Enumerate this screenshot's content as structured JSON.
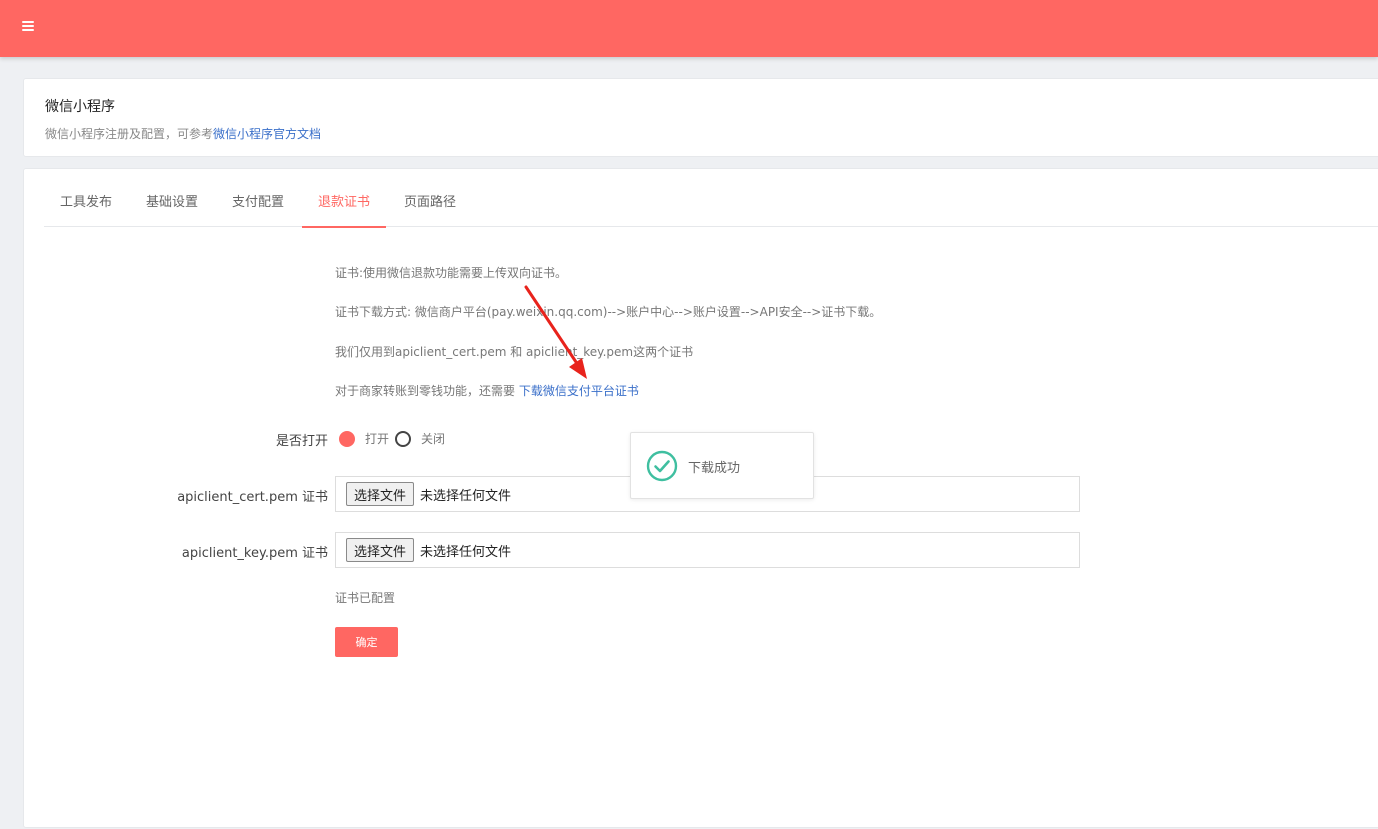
{
  "header": {
    "menu_icon": "hamburger-menu-icon"
  },
  "intro": {
    "title": "微信小程序",
    "subtitle_prefix": "微信小程序注册及配置，可参考",
    "subtitle_link": "微信小程序官方文档"
  },
  "tabs": [
    {
      "label": "工具发布"
    },
    {
      "label": "基础设置"
    },
    {
      "label": "支付配置"
    },
    {
      "label": "退款证书",
      "active": true
    },
    {
      "label": "页面路径"
    }
  ],
  "info": {
    "line1": "证书:使用微信退款功能需要上传双向证书。",
    "line2": "证书下载方式: 微信商户平台(pay.weixin.qq.com)-->账户中心-->账户设置-->API安全-->证书下载。",
    "line3": "我们仅用到apiclient_cert.pem 和 apiclient_key.pem这两个证书",
    "line4_prefix": "对于商家转账到零钱功能，还需要 ",
    "line4_link": "下载微信支付平台证书"
  },
  "form": {
    "enable_label": "是否打开",
    "radio_on": "打开",
    "radio_off": "关闭",
    "cert_label": "apiclient_cert.pem 证书",
    "key_label": "apiclient_key.pem 证书",
    "choose_file": "选择文件",
    "no_file": "未选择任何文件",
    "status": "证书已配置",
    "submit": "确定"
  },
  "toast": {
    "text": "下载成功",
    "icon": "check-circle-icon"
  },
  "colors": {
    "accent": "#ff6762",
    "link": "#3a6fc9",
    "success": "#3fbfa0",
    "annotation": "#e8231c"
  }
}
